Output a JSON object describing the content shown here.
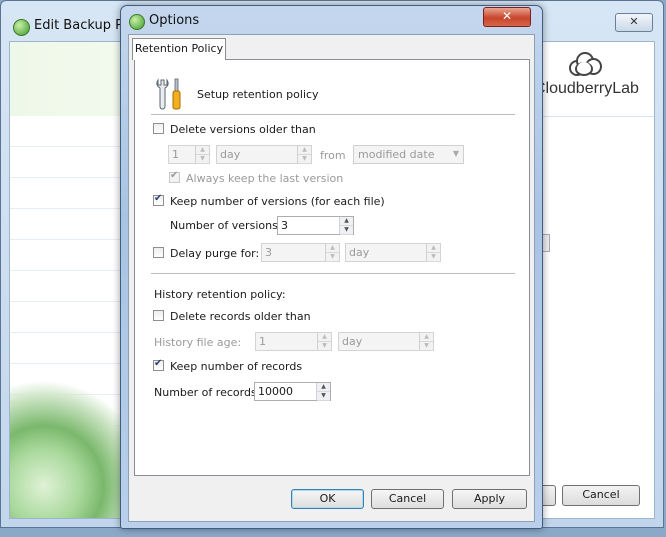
{
  "background_window": {
    "title": "Edit Backup Plan",
    "close_glyph": "✕",
    "logo_text": "CloudberryLab",
    "partial_button_label": "",
    "cancel_label": "Cancel"
  },
  "dialog": {
    "title": "Options",
    "close_glyph": "✕",
    "tab_label": "Retention Policy",
    "header_text": "Setup retention policy",
    "delete_versions": {
      "label": "Delete versions older than",
      "checked": false,
      "value": "1",
      "unit": "day",
      "from_label": "from",
      "from_value": "modified date"
    },
    "always_keep_last": {
      "label": "Always keep the last version",
      "checked": true
    },
    "keep_versions": {
      "label": "Keep number of versions (for each file)",
      "checked": true,
      "count_label": "Number of versions:",
      "count_value": "3"
    },
    "delay_purge": {
      "label": "Delay purge for:",
      "checked": false,
      "value": "3",
      "unit": "day"
    },
    "history": {
      "heading": "History retention policy:",
      "delete_records": {
        "label": "Delete records older than",
        "checked": false
      },
      "file_age_label": "History file age:",
      "file_age_value": "1",
      "file_age_unit": "day",
      "keep_records": {
        "label": "Keep number of records",
        "checked": true
      },
      "records_label": "Number of records:",
      "records_value": "10000"
    },
    "buttons": {
      "ok": "OK",
      "cancel": "Cancel",
      "apply": "Apply"
    }
  },
  "icons": [
    "app-icon",
    "cloud-logo-icon",
    "tools-icon",
    "close-icon",
    "spin-up-icon",
    "spin-down-icon",
    "dropdown-arrow-icon"
  ]
}
